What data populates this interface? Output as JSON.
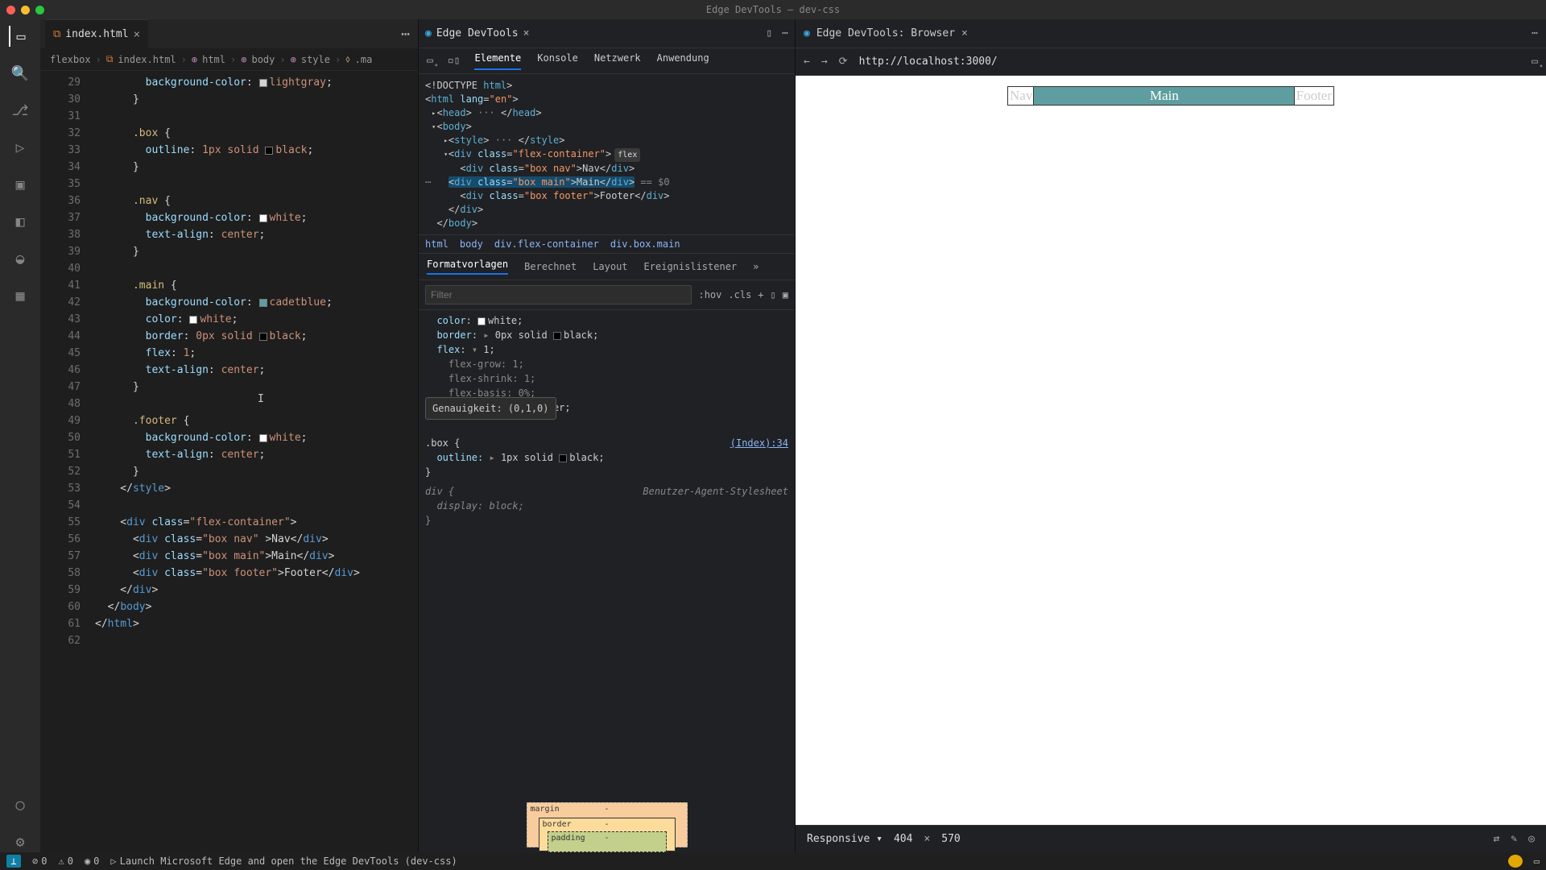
{
  "window_title": "Edge DevTools — dev-css",
  "editor": {
    "tab": {
      "filename": "index.html"
    },
    "breadcrumbs": [
      "flexbox",
      "index.html",
      "html",
      "body",
      "style",
      ".ma"
    ],
    "line_start": 29,
    "lines": [
      "        background-color: ◻ lightgray;",
      "      }",
      "",
      "      .box {",
      "        outline: 1px solid ◻ black;",
      "      }",
      "",
      "      .nav {",
      "        background-color: ◻ white;",
      "        text-align: center;",
      "      }",
      "",
      "      .main {",
      "        background-color: ◻ cadetblue;",
      "        color: ◻ white;",
      "        border: 0px solid ◻ black;",
      "        flex: 1;",
      "        text-align: center;",
      "      }",
      "",
      "      .footer {",
      "        background-color: ◻ white;",
      "        text-align: center;",
      "      }",
      "    </style>",
      "",
      "    <div class=\"flex-container\">",
      "      <div class=\"box nav\" >Nav</div>",
      "      <div class=\"box main\">Main</div>",
      "      <div class=\"box footer\">Footer</div>",
      "    </div>",
      "  </body>",
      "</html>",
      ""
    ]
  },
  "devtools": {
    "title": "Edge DevTools",
    "toolbar_tabs": [
      "Elemente",
      "Konsole",
      "Netzwerk",
      "Anwendung"
    ],
    "dom_lines": [
      "<!DOCTYPE html>",
      "<html lang=\"en\">",
      "  ▸ <head> ··· </head>",
      "  ▾ <body>",
      "    ▸ <style> ··· </style>",
      "    ▾ <div class=\"flex-container\">  flex",
      "        <div class=\"box nav\">Nav</div>",
      "        <div class=\"box main\">Main</div>  == $0",
      "        <div class=\"box footer\">Footer</div>",
      "      </div>",
      "    </body>"
    ],
    "crumbs": [
      "html",
      "body",
      "div.flex-container",
      "div.box.main"
    ],
    "style_tabs": [
      "Formatvorlagen",
      "Berechnet",
      "Layout",
      "Ereignislistener"
    ],
    "filter_placeholder": "Filter",
    "hov": ":hov",
    "cls": ".cls",
    "rules": {
      "color_val": "white;",
      "border_val": "0px solid",
      "border_col": "black;",
      "flex_val": "1;",
      "grow": "flex-grow: 1;",
      "shrink": "flex-shrink: 1;",
      "basis": "flex-basis: 0%;",
      "align_tail": "nter;",
      "tooltip": "Genauigkeit: (0,1,0)",
      "box_sel": ".box {",
      "box_src": "(Index):34",
      "outline": "outline:",
      "outline_val": "1px solid",
      "outline_col": "black;",
      "div_sel": "div {",
      "ua_label": "Benutzer-Agent-Stylesheet",
      "display": "display: block;"
    },
    "boxmodel": {
      "margin": "margin",
      "border": "border",
      "padding": "padding",
      "dash": "-"
    }
  },
  "browser": {
    "title": "Edge DevTools: Browser",
    "url": "http://localhost:3000/",
    "render": {
      "nav": "Nav",
      "main": "Main",
      "footer": "Footer"
    },
    "device": {
      "mode": "Responsive",
      "w": "404",
      "h": "570"
    }
  },
  "status": {
    "err": "0",
    "warn": "0",
    "port": "0",
    "launch": "Launch Microsoft Edge and open the Edge DevTools (dev-css)"
  }
}
